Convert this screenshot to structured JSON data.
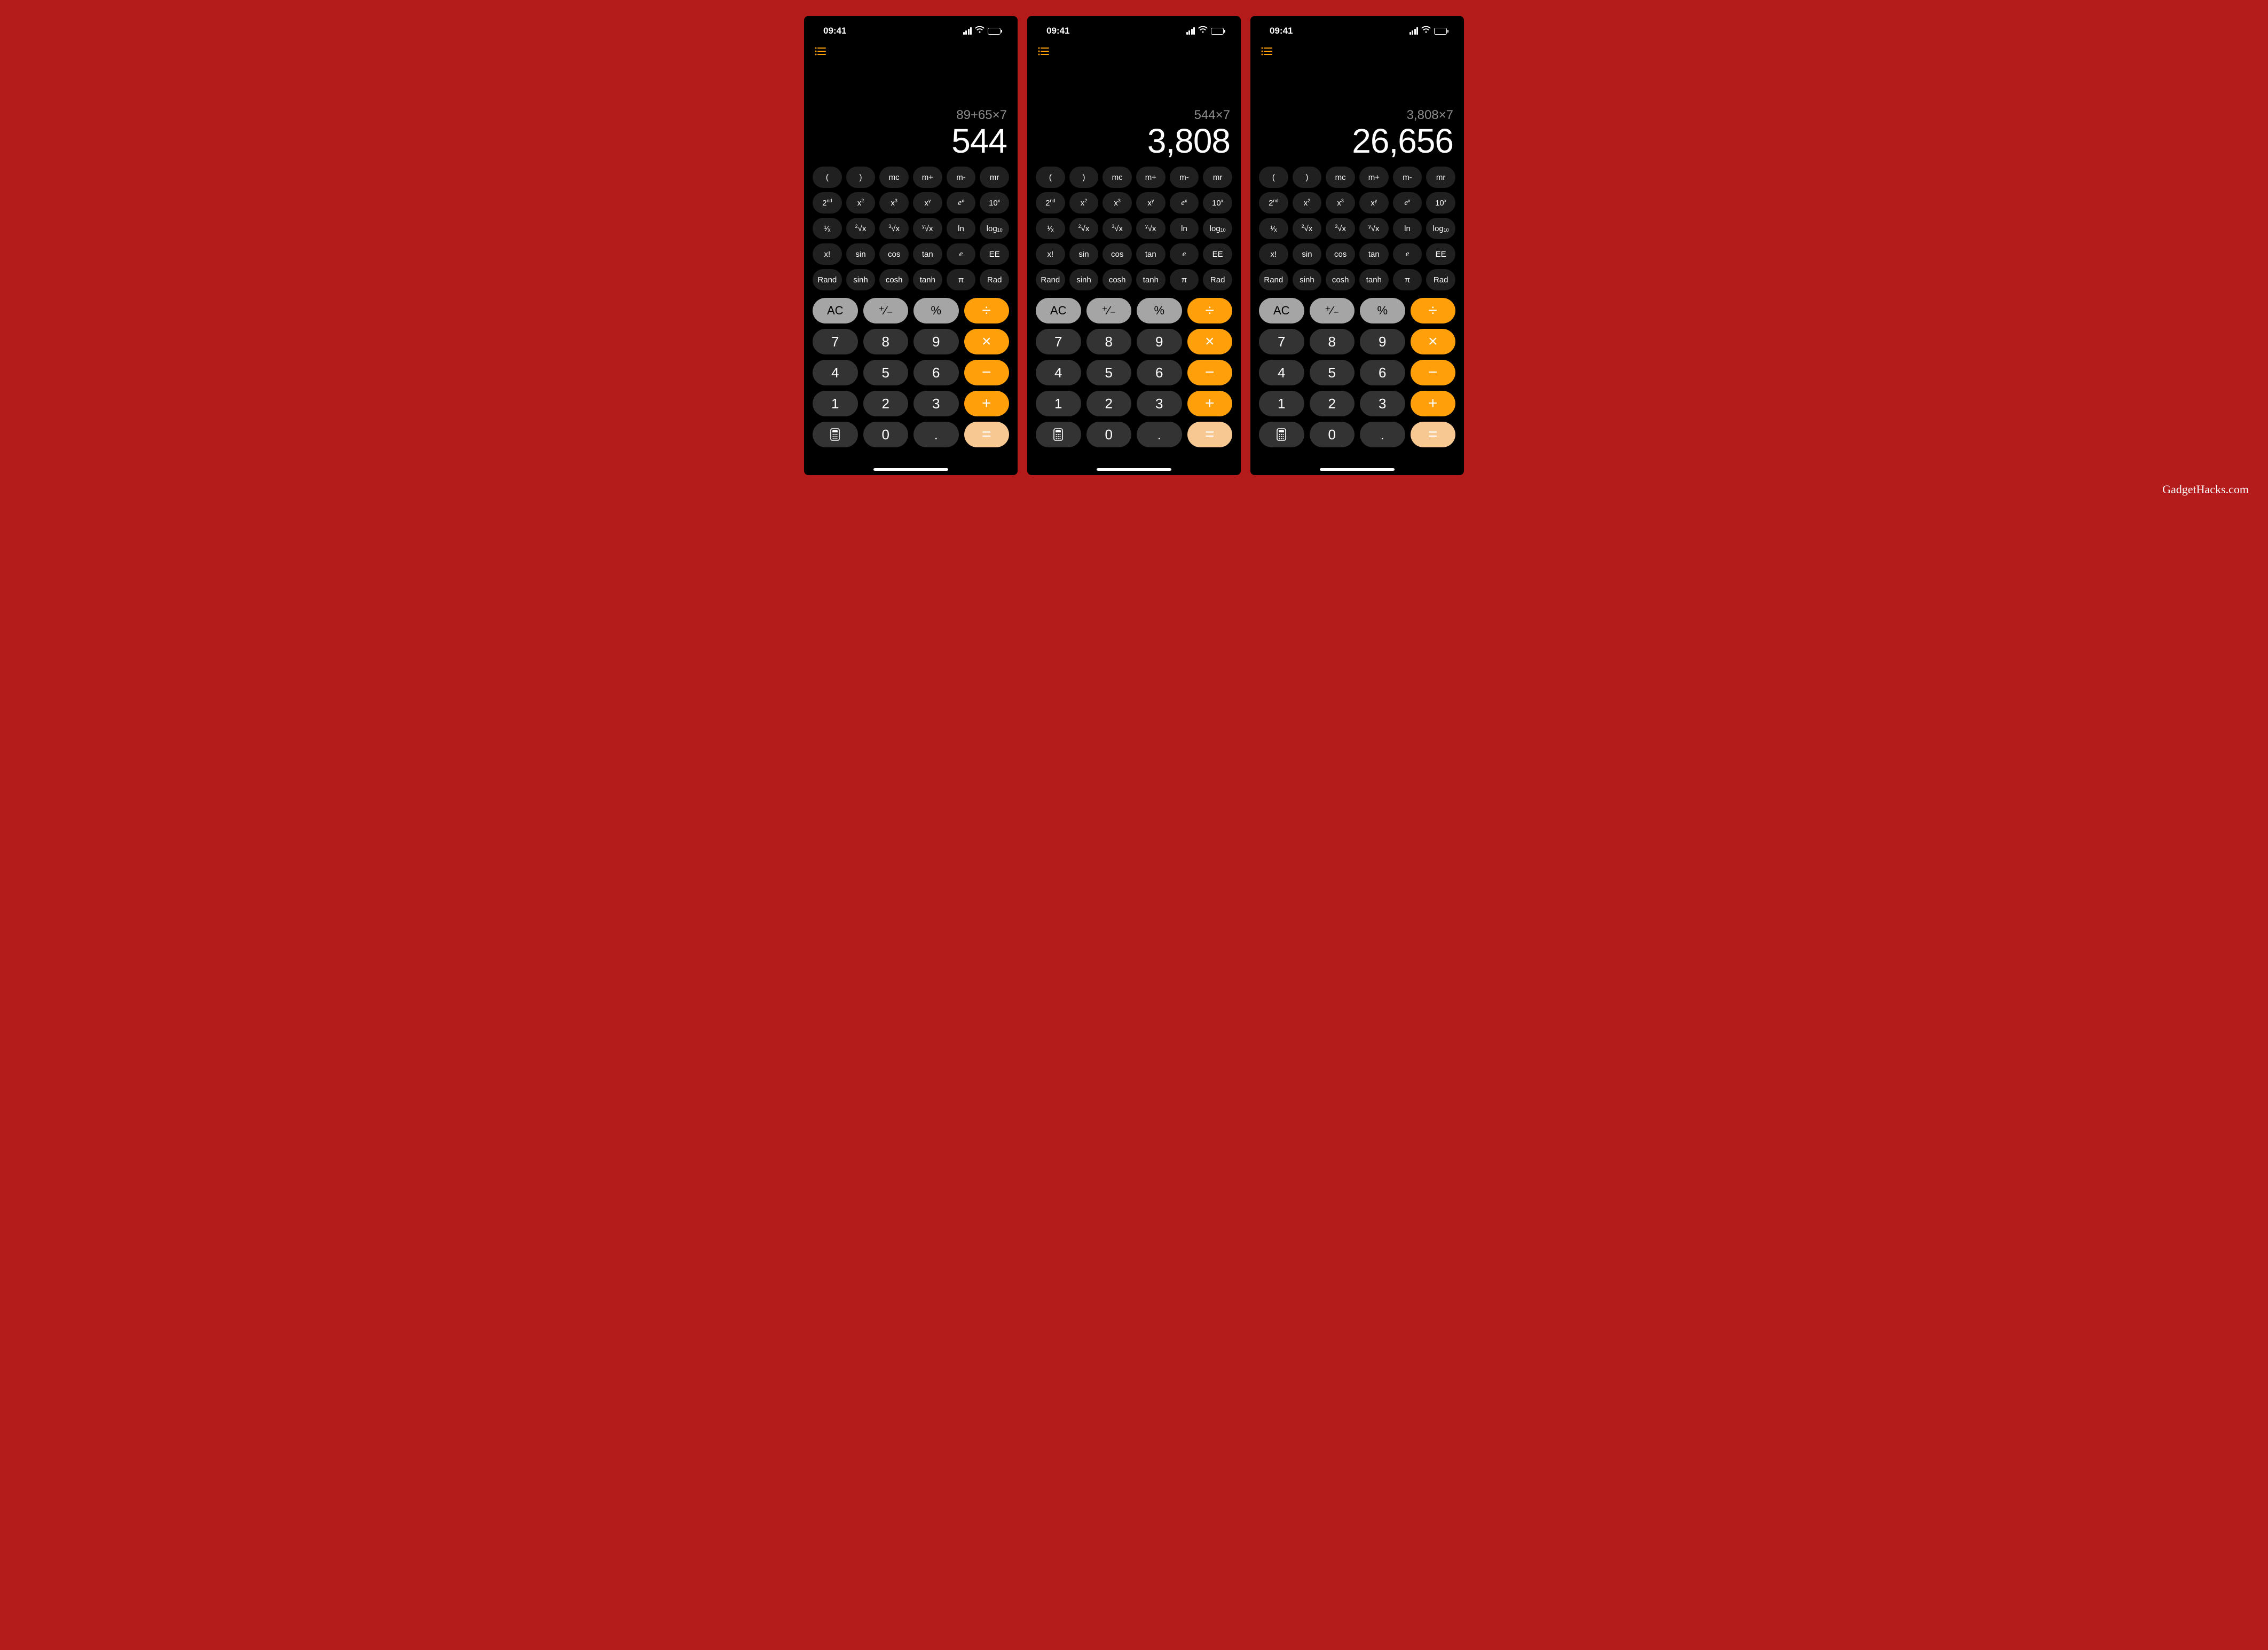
{
  "watermark": "GadgetHacks.com",
  "status_time": "09:41",
  "colors": {
    "background": "#b41c1c",
    "orange": "#ff9f0a",
    "equals": "#f7c891",
    "light_gray": "#a5a5a5",
    "dark_gray": "#333333",
    "sci_gray": "#202020",
    "history_icon": "#ff9f0a"
  },
  "screens": [
    {
      "expression": "89+65×7",
      "result": "544"
    },
    {
      "expression": "544×7",
      "result": "3,808"
    },
    {
      "expression": "3,808×7",
      "result": "26,656"
    }
  ],
  "sci_rows": [
    [
      "(",
      ")",
      "mc",
      "m+",
      "m-",
      "mr"
    ],
    [
      "2<sup>nd</sup>",
      "x<sup>2</sup>",
      "x<sup>3</sup>",
      "x<sup>y</sup>",
      "<span class='italic'>e</span><sup>x</sup>",
      "10<sup>x</sup>"
    ],
    [
      "¹⁄ₓ",
      "<sup>2</sup>√x",
      "<sup>3</sup>√x",
      "<sup>y</sup>√x",
      "ln",
      "log<sub>10</sub>"
    ],
    [
      "x!",
      "sin",
      "cos",
      "tan",
      "<span class='italic'>e</span>",
      "EE"
    ],
    [
      "Rand",
      "sinh",
      "cosh",
      "tanh",
      "π",
      "Rad"
    ]
  ],
  "sci_names": [
    [
      "paren-open",
      "paren-close",
      "memory-clear",
      "memory-add",
      "memory-subtract",
      "memory-recall"
    ],
    [
      "second-fn",
      "x-squared",
      "x-cubed",
      "x-power-y",
      "e-power-x",
      "ten-power-x"
    ],
    [
      "one-over-x",
      "sqrt",
      "cbrt",
      "y-root-x",
      "ln",
      "log10"
    ],
    [
      "factorial",
      "sin",
      "cos",
      "tan",
      "euler-e",
      "ee"
    ],
    [
      "rand",
      "sinh",
      "cosh",
      "tanh",
      "pi",
      "rad"
    ]
  ],
  "main_rows": [
    [
      {
        "label": "AC",
        "class": "btn-light",
        "name": "clear-button"
      },
      {
        "label": "⁺∕₋",
        "class": "btn-light",
        "name": "negate-button"
      },
      {
        "label": "%",
        "class": "btn-light",
        "name": "percent-button"
      },
      {
        "label": "÷",
        "class": "btn-orange",
        "name": "divide-button"
      }
    ],
    [
      {
        "label": "7",
        "class": "btn-dark",
        "name": "seven-button"
      },
      {
        "label": "8",
        "class": "btn-dark",
        "name": "eight-button"
      },
      {
        "label": "9",
        "class": "btn-dark",
        "name": "nine-button"
      },
      {
        "label": "×",
        "class": "btn-orange",
        "name": "multiply-button"
      }
    ],
    [
      {
        "label": "4",
        "class": "btn-dark",
        "name": "four-button"
      },
      {
        "label": "5",
        "class": "btn-dark",
        "name": "five-button"
      },
      {
        "label": "6",
        "class": "btn-dark",
        "name": "six-button"
      },
      {
        "label": "−",
        "class": "btn-orange",
        "name": "minus-button"
      }
    ],
    [
      {
        "label": "1",
        "class": "btn-dark",
        "name": "one-button"
      },
      {
        "label": "2",
        "class": "btn-dark",
        "name": "two-button"
      },
      {
        "label": "3",
        "class": "btn-dark",
        "name": "three-button"
      },
      {
        "label": "+",
        "class": "btn-orange",
        "name": "plus-button"
      }
    ],
    [
      {
        "label": "__CALC_ICON__",
        "class": "btn-dark",
        "name": "calculator-mode-button"
      },
      {
        "label": "0",
        "class": "btn-dark",
        "name": "zero-button"
      },
      {
        "label": ".",
        "class": "btn-dark",
        "name": "decimal-button"
      },
      {
        "label": "=",
        "class": "btn-equals",
        "name": "equals-button"
      }
    ]
  ]
}
